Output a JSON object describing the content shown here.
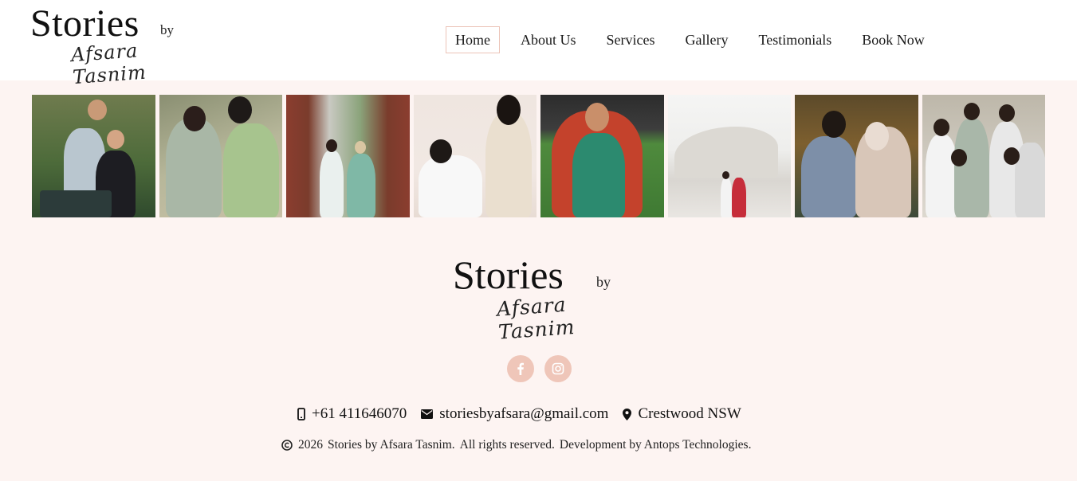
{
  "header": {
    "logo": {
      "main": "Stories",
      "by": "by",
      "script": "Afsara Tasnim"
    },
    "nav": [
      {
        "label": "Home"
      },
      {
        "label": "About Us"
      },
      {
        "label": "Services"
      },
      {
        "label": "Gallery"
      },
      {
        "label": "Testimonials"
      },
      {
        "label": "Book Now"
      }
    ]
  },
  "gallery": [
    {
      "icon": "family-photo"
    },
    {
      "icon": "couple-photo"
    },
    {
      "icon": "couple-garden-photo"
    },
    {
      "icon": "maternity-photo"
    },
    {
      "icon": "bride-portrait-photo"
    },
    {
      "icon": "opera-house-couple-photo"
    },
    {
      "icon": "wedding-couple-photo"
    },
    {
      "icon": "bridal-party-photo"
    }
  ],
  "footer": {
    "logo": {
      "main": "Stories",
      "by": "by",
      "script": "Afsara Tasnim"
    },
    "social": [
      {
        "icon": "facebook-icon"
      },
      {
        "icon": "instagram-icon"
      }
    ],
    "contact": {
      "phone": "+61 411646070",
      "email": "storiesbyafsara@gmail.com",
      "location": "Crestwood NSW"
    },
    "copyright": {
      "year": "2026",
      "owner": "Stories by Afsara Tasnim.",
      "rights": "All rights reserved.",
      "dev": "Development by Antops Technologies."
    }
  },
  "colors": {
    "background": "#fdf4f2",
    "accent": "#efc6b9",
    "nav_active_border": "#ecc4b8"
  }
}
